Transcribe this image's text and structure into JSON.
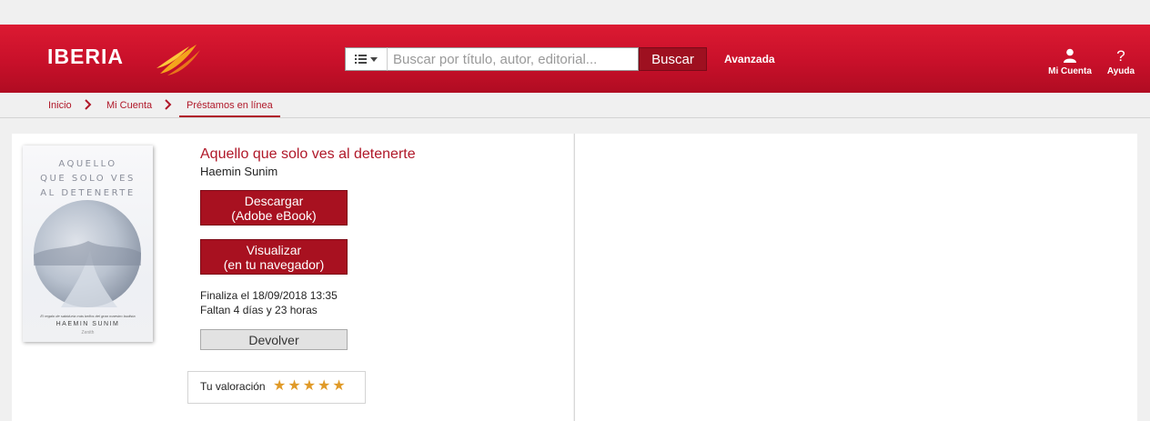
{
  "header": {
    "logo_text": "IBERIA",
    "search": {
      "placeholder": "Buscar por título, autor, editorial...",
      "button_label": "Buscar"
    },
    "advanced_label": "Avanzada",
    "account_label": "Mi Cuenta",
    "help_label": "Ayuda",
    "help_glyph": "?"
  },
  "breadcrumb": {
    "items": [
      "Inicio",
      "Mi Cuenta",
      "Préstamos en línea"
    ]
  },
  "book": {
    "cover": {
      "title_line1": "AQUELLO",
      "title_line2": "QUE SOLO VES",
      "title_line3": "AL DETENERTE",
      "subtitle": "El regalo de sabiduría más bellos del gran maestro budista",
      "author": "HAEMIN SUNIM",
      "publisher": "Zenith"
    },
    "title": "Aquello que solo ves al detenerte",
    "author": "Haemin Sunim",
    "download_line1": "Descargar",
    "download_line2": "(Adobe eBook)",
    "view_line1": "Visualizar",
    "view_line2": "(en tu navegador)",
    "ends": "Finaliza el 18/09/2018 13:35",
    "remaining": "Faltan 4 días y 23 horas",
    "return_label": "Devolver",
    "rating_label": "Tu valoración",
    "rating": 5
  },
  "colors": {
    "brand_red": "#c8102a",
    "button_red": "#a81120",
    "star": "#e09a28"
  }
}
